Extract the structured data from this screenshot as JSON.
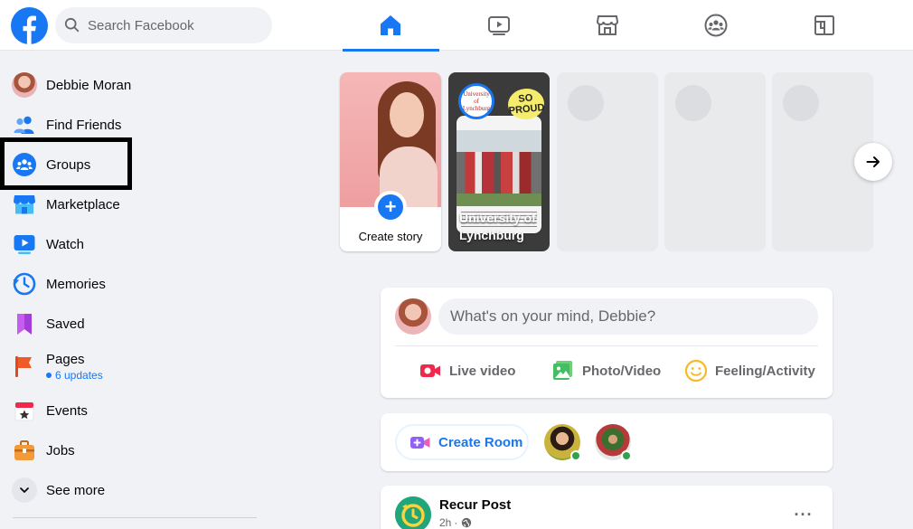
{
  "search": {
    "placeholder": "Search Facebook"
  },
  "nav_tabs": [
    "home",
    "watch",
    "marketplace",
    "groups",
    "gaming"
  ],
  "sidebar": {
    "items": [
      {
        "label": "Debbie Moran",
        "icon": "profile-avatar"
      },
      {
        "label": "Find Friends",
        "icon": "friends-icon"
      },
      {
        "label": "Groups",
        "icon": "groups-icon"
      },
      {
        "label": "Marketplace",
        "icon": "marketplace-icon"
      },
      {
        "label": "Watch",
        "icon": "watch-icon"
      },
      {
        "label": "Memories",
        "icon": "memories-icon"
      },
      {
        "label": "Saved",
        "icon": "saved-icon"
      },
      {
        "label": "Pages",
        "icon": "pages-icon",
        "sub": "6 updates"
      },
      {
        "label": "Events",
        "icon": "events-icon"
      },
      {
        "label": "Jobs",
        "icon": "jobs-icon"
      },
      {
        "label": "See more",
        "icon": "chevron-down-icon"
      }
    ]
  },
  "stories": {
    "create_label": "Create story",
    "uni_name": "University of Lynchburg",
    "uni_logo_text": "University of Lynchburg",
    "uni_sticker": "SO PROUD"
  },
  "composer": {
    "placeholder": "What's on your mind, Debbie?",
    "actions": [
      "Live video",
      "Photo/Video",
      "Feeling/Activity"
    ]
  },
  "rooms": {
    "create_label": "Create Room"
  },
  "post": {
    "author": "Recur Post",
    "time": "2h",
    "more": "···"
  },
  "colors": {
    "brand": "#1877f2",
    "online": "#31a24c",
    "highlight_border": "#000000"
  }
}
